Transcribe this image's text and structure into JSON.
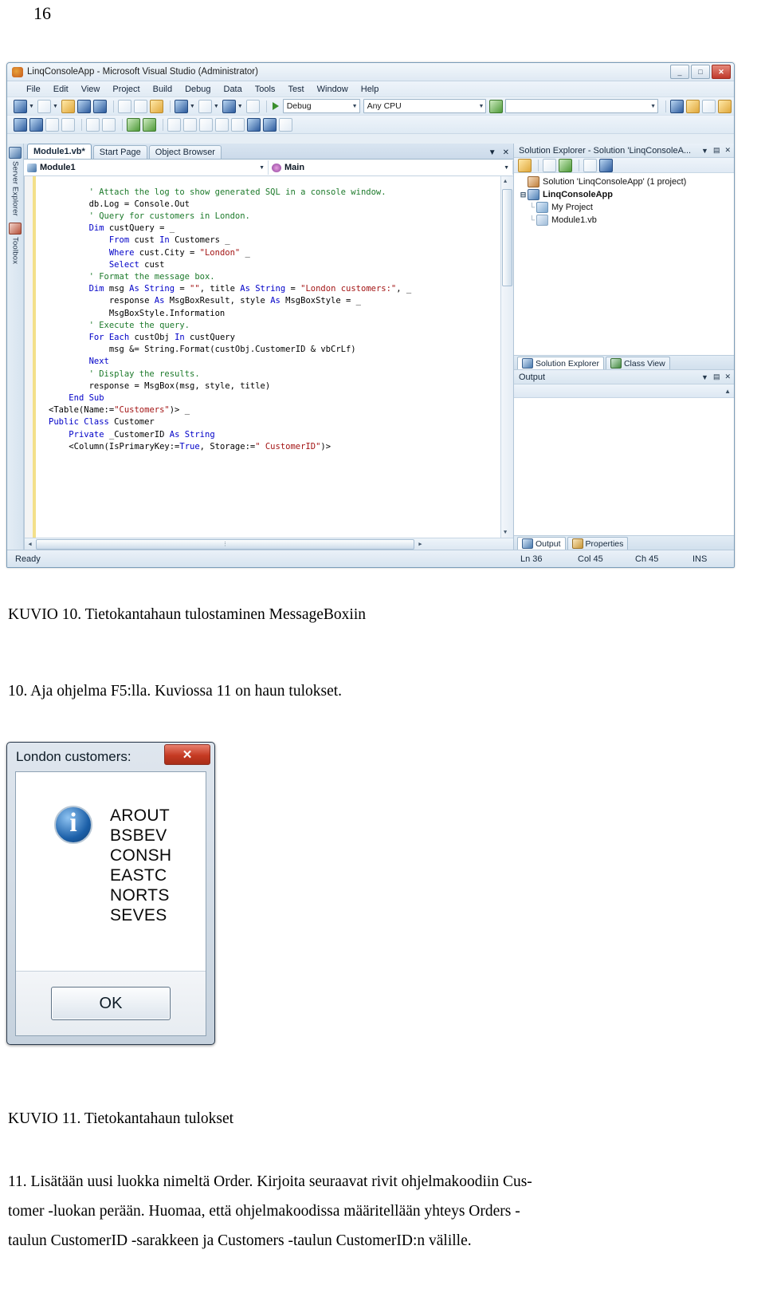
{
  "page_number": "16",
  "vs_window": {
    "title": "LinqConsoleApp - Microsoft Visual Studio (Administrator)",
    "window_buttons": {
      "minimize": "_",
      "maximize": "□",
      "close": "✕"
    },
    "menu": [
      "File",
      "Edit",
      "View",
      "Project",
      "Build",
      "Debug",
      "Data",
      "Tools",
      "Test",
      "Window",
      "Help"
    ],
    "toolbar": {
      "config_combo": "Debug",
      "platform_combo": "Any CPU",
      "start_label": "Start"
    },
    "left_rail": [
      "Server Explorer",
      "Toolbox"
    ],
    "tabs": [
      {
        "label": "Module1.vb*",
        "active": true
      },
      {
        "label": "Start Page",
        "active": false
      },
      {
        "label": "Object Browser",
        "active": false
      }
    ],
    "nav_bar": {
      "type_combo": "Module1",
      "member_combo": "Main"
    },
    "code_lines": [
      {
        "indent": 8,
        "parts": [
          {
            "t": "' Attach the log to show generated SQL in a console window.",
            "c": "cmt"
          }
        ]
      },
      {
        "indent": 8,
        "parts": [
          {
            "t": "db.Log = Console.Out",
            "c": ""
          }
        ]
      },
      {
        "indent": 0,
        "parts": [
          {
            "t": "",
            "c": ""
          }
        ]
      },
      {
        "indent": 8,
        "parts": [
          {
            "t": "' Query for customers in London.",
            "c": "cmt"
          }
        ]
      },
      {
        "indent": 8,
        "parts": [
          {
            "t": "Dim",
            "c": "kw"
          },
          {
            "t": " custQuery = _",
            "c": ""
          }
        ]
      },
      {
        "indent": 12,
        "parts": [
          {
            "t": "From",
            "c": "kw"
          },
          {
            "t": " cust ",
            "c": ""
          },
          {
            "t": "In",
            "c": "kw"
          },
          {
            "t": " Customers _",
            "c": ""
          }
        ]
      },
      {
        "indent": 12,
        "parts": [
          {
            "t": "Where",
            "c": "kw"
          },
          {
            "t": " cust.City = ",
            "c": ""
          },
          {
            "t": "\"London\"",
            "c": "str"
          },
          {
            "t": " _",
            "c": ""
          }
        ]
      },
      {
        "indent": 12,
        "parts": [
          {
            "t": "Select",
            "c": "kw"
          },
          {
            "t": " cust",
            "c": ""
          }
        ]
      },
      {
        "indent": 0,
        "parts": [
          {
            "t": "",
            "c": ""
          }
        ]
      },
      {
        "indent": 8,
        "parts": [
          {
            "t": "' Format the message box.",
            "c": "cmt"
          }
        ]
      },
      {
        "indent": 8,
        "parts": [
          {
            "t": "Dim",
            "c": "kw"
          },
          {
            "t": " msg ",
            "c": ""
          },
          {
            "t": "As String",
            "c": "kw"
          },
          {
            "t": " = ",
            "c": ""
          },
          {
            "t": "\"\"",
            "c": "str"
          },
          {
            "t": ", title ",
            "c": ""
          },
          {
            "t": "As String",
            "c": "kw"
          },
          {
            "t": " = ",
            "c": ""
          },
          {
            "t": "\"London customers:\"",
            "c": "str"
          },
          {
            "t": ", _",
            "c": ""
          }
        ]
      },
      {
        "indent": 12,
        "parts": [
          {
            "t": "response ",
            "c": ""
          },
          {
            "t": "As",
            "c": "kw"
          },
          {
            "t": " MsgBoxResult, style ",
            "c": ""
          },
          {
            "t": "As",
            "c": "kw"
          },
          {
            "t": " MsgBoxStyle = _",
            "c": ""
          }
        ]
      },
      {
        "indent": 12,
        "parts": [
          {
            "t": "MsgBoxStyle.Information",
            "c": ""
          }
        ]
      },
      {
        "indent": 0,
        "parts": [
          {
            "t": "",
            "c": ""
          }
        ]
      },
      {
        "indent": 8,
        "parts": [
          {
            "t": "' Execute the query.",
            "c": "cmt"
          }
        ]
      },
      {
        "indent": 8,
        "parts": [
          {
            "t": "For Each",
            "c": "kw"
          },
          {
            "t": " custObj ",
            "c": ""
          },
          {
            "t": "In",
            "c": "kw"
          },
          {
            "t": " custQuery",
            "c": ""
          }
        ]
      },
      {
        "indent": 12,
        "parts": [
          {
            "t": "msg &= String.Format(custObj.CustomerID & vbCrLf)",
            "c": ""
          }
        ]
      },
      {
        "indent": 8,
        "parts": [
          {
            "t": "Next",
            "c": "kw"
          }
        ]
      },
      {
        "indent": 0,
        "parts": [
          {
            "t": "",
            "c": ""
          }
        ]
      },
      {
        "indent": 8,
        "parts": [
          {
            "t": "' Display the results.",
            "c": "cmt"
          }
        ]
      },
      {
        "indent": 8,
        "parts": [
          {
            "t": "response = MsgBox(msg, style, title)",
            "c": ""
          }
        ]
      },
      {
        "indent": 0,
        "parts": [
          {
            "t": "",
            "c": ""
          }
        ]
      },
      {
        "indent": 4,
        "parts": [
          {
            "t": "End Sub",
            "c": "kw"
          }
        ]
      },
      {
        "indent": 0,
        "parts": [
          {
            "t": "<Table(Name:=",
            "c": ""
          },
          {
            "t": "\"Customers\"",
            "c": "str"
          },
          {
            "t": ")> _",
            "c": ""
          }
        ]
      },
      {
        "indent": 0,
        "parts": [
          {
            "t": "Public Class",
            "c": "kw"
          },
          {
            "t": " Customer",
            "c": ""
          }
        ]
      },
      {
        "indent": 0,
        "parts": [
          {
            "t": "",
            "c": ""
          }
        ]
      },
      {
        "indent": 4,
        "parts": [
          {
            "t": "Private",
            "c": "kw"
          },
          {
            "t": " _CustomerID ",
            "c": ""
          },
          {
            "t": "As String",
            "c": "kw"
          }
        ]
      },
      {
        "indent": 4,
        "parts": [
          {
            "t": "<Column(IsPrimaryKey:=",
            "c": ""
          },
          {
            "t": "True",
            "c": "kw"
          },
          {
            "t": ", Storage:=",
            "c": ""
          },
          {
            "t": "\" CustomerID\"",
            "c": "str"
          },
          {
            "t": ")>",
            "c": ""
          }
        ]
      }
    ],
    "solution_explorer": {
      "title": "Solution Explorer - Solution 'LinqConsoleA...",
      "tree": [
        {
          "label": "Solution 'LinqConsoleApp' (1 project)",
          "level": 0,
          "icon": "solution-icon",
          "bold": false,
          "expander": ""
        },
        {
          "label": "LinqConsoleApp",
          "level": 0,
          "icon": "project-icon",
          "bold": true,
          "expander": "⊟"
        },
        {
          "label": "My Project",
          "level": 1,
          "icon": "my-project-icon",
          "bold": false,
          "expander": ""
        },
        {
          "label": "Module1.vb",
          "level": 1,
          "icon": "vb-file-icon",
          "bold": false,
          "expander": ""
        }
      ]
    },
    "dock_tabs_top": [
      {
        "label": "Solution Explorer",
        "active": true
      },
      {
        "label": "Class View",
        "active": false
      }
    ],
    "output_panel": {
      "title": "Output"
    },
    "dock_tabs_bottom": [
      {
        "label": "Output",
        "active": true
      },
      {
        "label": "Properties",
        "active": false
      }
    ],
    "status_bar": {
      "state": "Ready",
      "line": "Ln 36",
      "column": "Col 45",
      "character": "Ch 45",
      "insert_mode": "INS"
    }
  },
  "figure10_caption": "KUVIO 10. Tietokantahaun tulostaminen MessageBoxiin",
  "step10_text": "10. Aja ohjelma F5:lla. Kuviossa 11 on haun tulokset.",
  "message_box": {
    "title": "London customers:",
    "close_label": "✕",
    "icon": "information-icon",
    "icon_glyph": "i",
    "customers": [
      "AROUT",
      "BSBEV",
      "CONSH",
      "EASTC",
      "NORTS",
      "SEVES"
    ],
    "ok_label": "OK"
  },
  "figure11_caption": "KUVIO 11. Tietokantahaun tulokset",
  "step11_lines": [
    "11. Lisätään uusi luokka nimeltä Order. Kirjoita seuraavat rivit ohjelmakoodiin Cus-",
    "tomer -luokan perään. Huomaa, että ohjelmakoodissa määritellään yhteys Orders -",
    "taulun CustomerID -sarakkeen ja Customers -taulun CustomerID:n välille."
  ]
}
